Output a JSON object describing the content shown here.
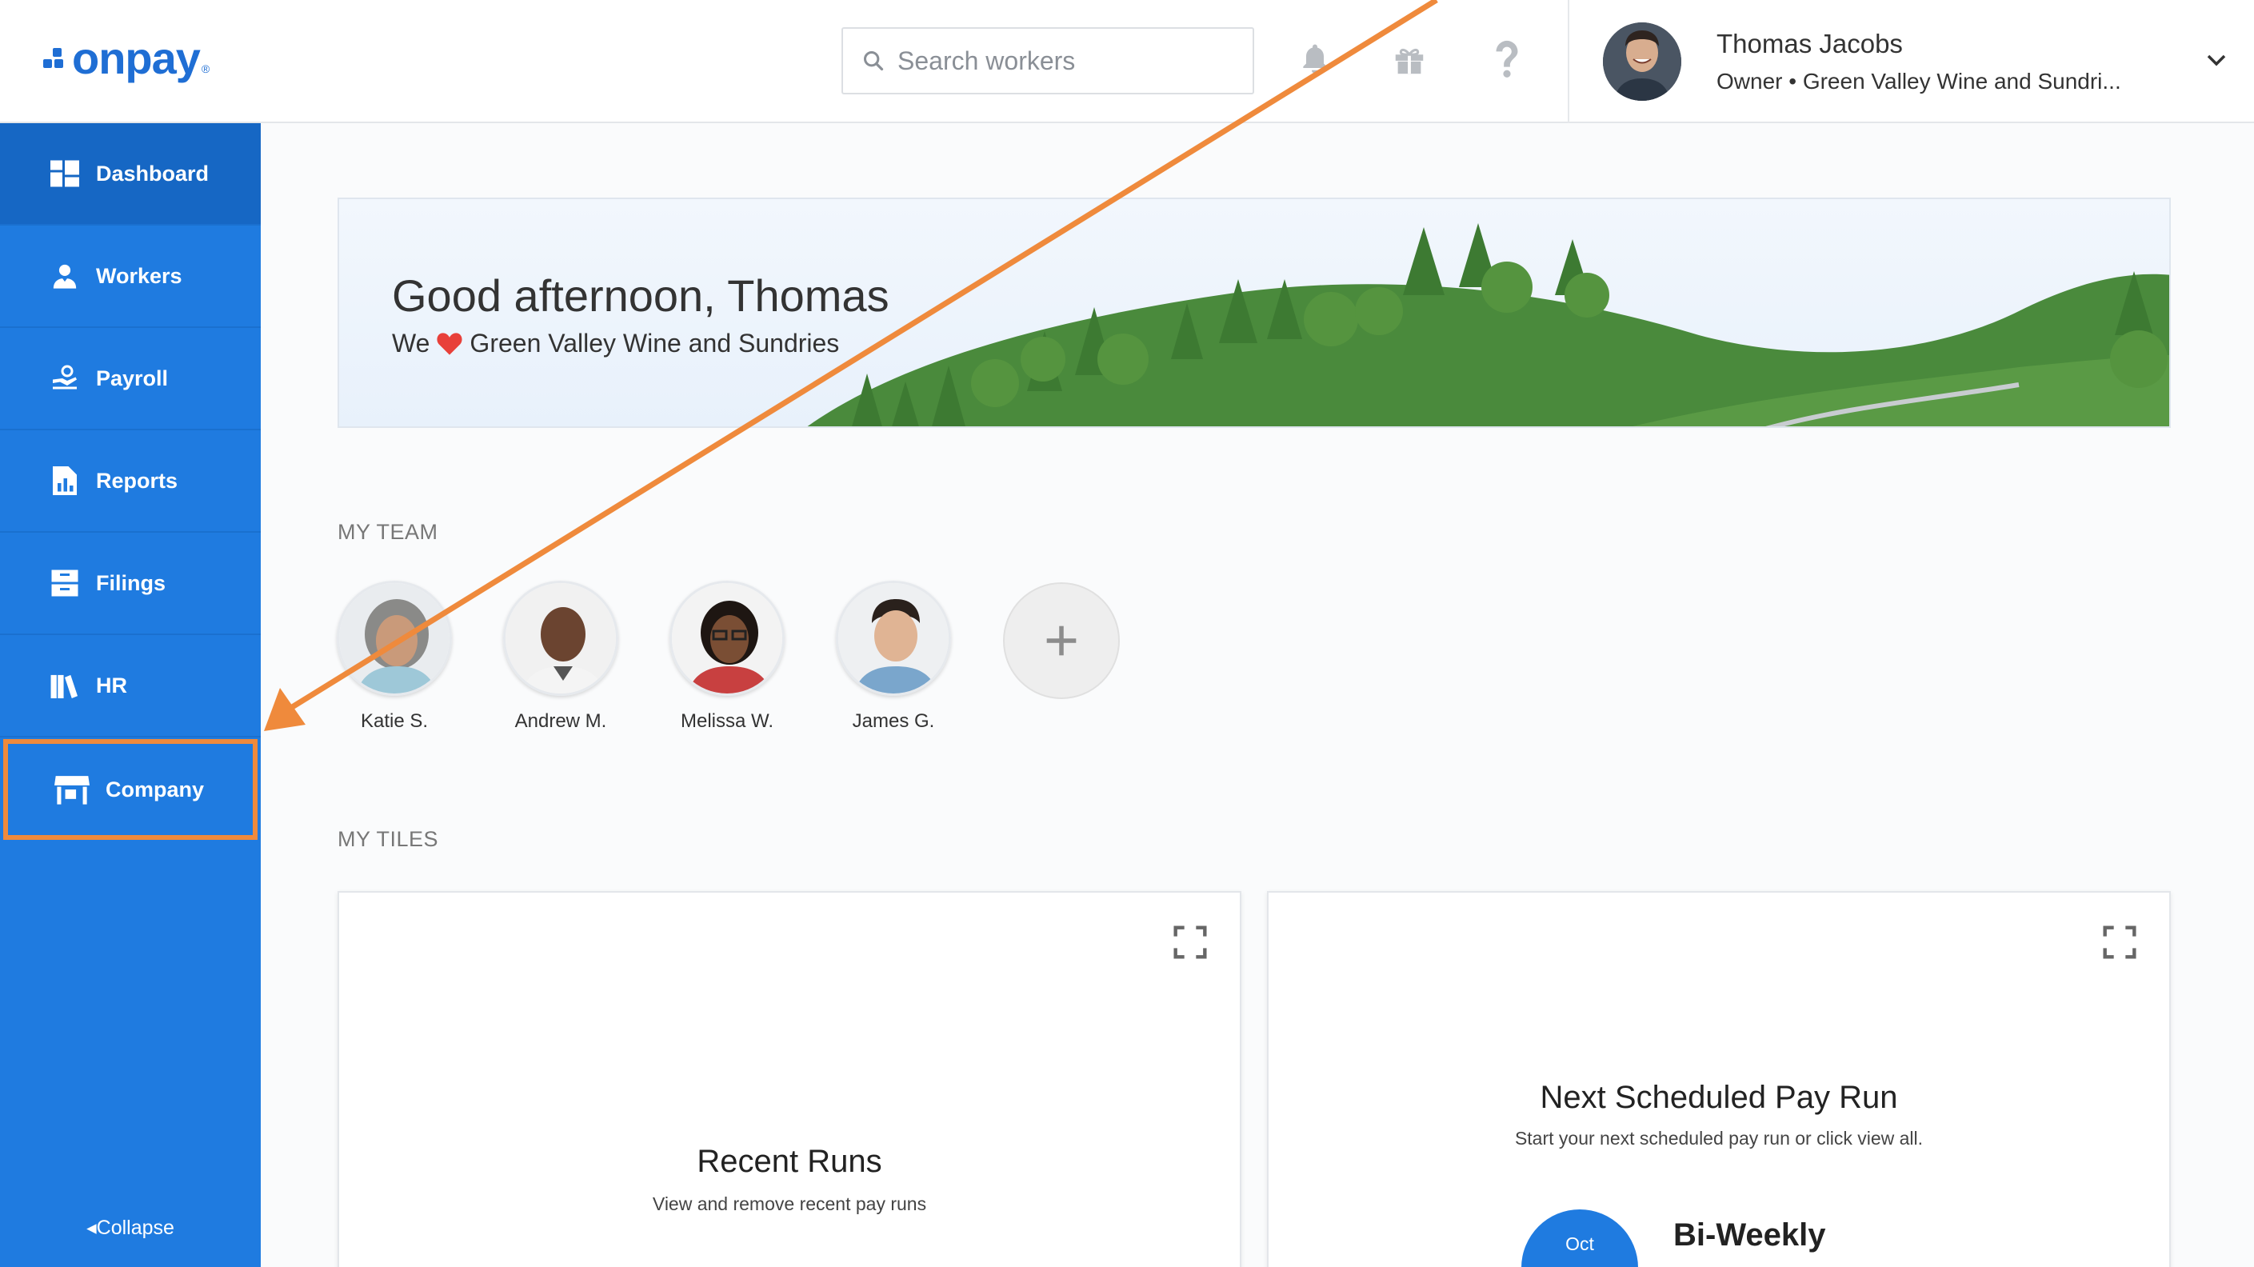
{
  "header": {
    "logo_text": "onpay",
    "logo_mark": "®",
    "search_placeholder": "Search workers",
    "user": {
      "name": "Thomas Jacobs",
      "role": "Owner • Green Valley Wine and Sundri..."
    }
  },
  "sidebar": {
    "items": [
      {
        "label": "Dashboard",
        "icon": "dashboard-icon"
      },
      {
        "label": "Workers",
        "icon": "workers-icon"
      },
      {
        "label": "Payroll",
        "icon": "payroll-icon"
      },
      {
        "label": "Reports",
        "icon": "reports-icon"
      },
      {
        "label": "Filings",
        "icon": "filings-icon"
      },
      {
        "label": "HR",
        "icon": "hr-icon"
      },
      {
        "label": "Company",
        "icon": "company-icon"
      }
    ],
    "collapse_label": "Collapse"
  },
  "hero": {
    "greeting": "Good afternoon, Thomas",
    "sub_prefix": "We",
    "sub_company": "Green Valley Wine and Sundries"
  },
  "team": {
    "label": "MY TEAM",
    "members": [
      {
        "name": "Katie S."
      },
      {
        "name": "Andrew M."
      },
      {
        "name": "Melissa W."
      },
      {
        "name": "James G."
      }
    ]
  },
  "tiles": {
    "label": "MY TILES",
    "recent_runs": {
      "title": "Recent Runs",
      "subtitle": "View and remove recent pay runs"
    },
    "next_pay_run": {
      "title": "Next Scheduled Pay Run",
      "subtitle": "Start your next scheduled pay run or click view all.",
      "month": "Oct",
      "frequency": "Bi-Weekly"
    }
  },
  "colors": {
    "brand": "#1f6ed4",
    "sidebar": "#1f7be0",
    "annotation": "#ef8a3c"
  }
}
